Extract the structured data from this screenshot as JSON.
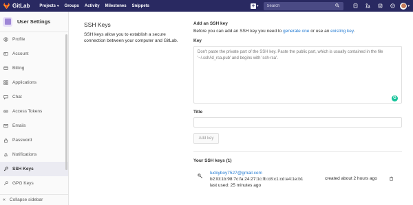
{
  "topbar": {
    "brand": "GitLab",
    "nav": [
      {
        "label": "Projects",
        "has_dropdown": true
      },
      {
        "label": "Groups"
      },
      {
        "label": "Activity"
      },
      {
        "label": "Milestones"
      },
      {
        "label": "Snippets"
      }
    ],
    "search_placeholder": "Search",
    "colors": {
      "background": "#292961",
      "search_bg": "#4a4a84"
    }
  },
  "sidebar": {
    "title": "User Settings",
    "items": [
      {
        "label": "Profile",
        "icon": "profile-icon"
      },
      {
        "label": "Account",
        "icon": "account-icon"
      },
      {
        "label": "Billing",
        "icon": "billing-icon"
      },
      {
        "label": "Applications",
        "icon": "applications-icon"
      },
      {
        "label": "Chat",
        "icon": "chat-icon"
      },
      {
        "label": "Access Tokens",
        "icon": "token-icon"
      },
      {
        "label": "Emails",
        "icon": "email-icon"
      },
      {
        "label": "Password",
        "icon": "lock-icon"
      },
      {
        "label": "Notifications",
        "icon": "bell-icon"
      },
      {
        "label": "SSH Keys",
        "icon": "key-icon",
        "active": true
      },
      {
        "label": "GPG Keys",
        "icon": "gpg-key-icon"
      }
    ],
    "collapse_label": "Collapse sidebar"
  },
  "main": {
    "section_title": "SSH Keys",
    "section_desc": "SSH keys allow you to establish a secure connection between your computer and GitLab.",
    "add_heading": "Add an SSH key",
    "intro_before": "Before you can add an SSH key you need to",
    "intro_link1": "generate one",
    "intro_mid": "or use an",
    "intro_link2": "existing key",
    "intro_after": ".",
    "key_label": "Key",
    "key_placeholder": "Don't paste the private part of the SSH key. Paste the public part, which is usually contained in the file '~/.ssh/id_rsa.pub' and begins with 'ssh-rsa'.",
    "title_label": "Title",
    "title_value": "",
    "add_button": "Add key",
    "your_keys_heading": "Your SSH keys (1)",
    "keys": [
      {
        "email": "luckyboy7527@gmail.com",
        "fingerprint": "b2:fd:1b:98:7c:fa:24:27:1c:fb:c8:c1:cd:e4:1e:b1",
        "last_used": "last used: 25 minutes ago",
        "created": "created about 2 hours ago"
      }
    ],
    "link_color": "#1f78d1"
  }
}
